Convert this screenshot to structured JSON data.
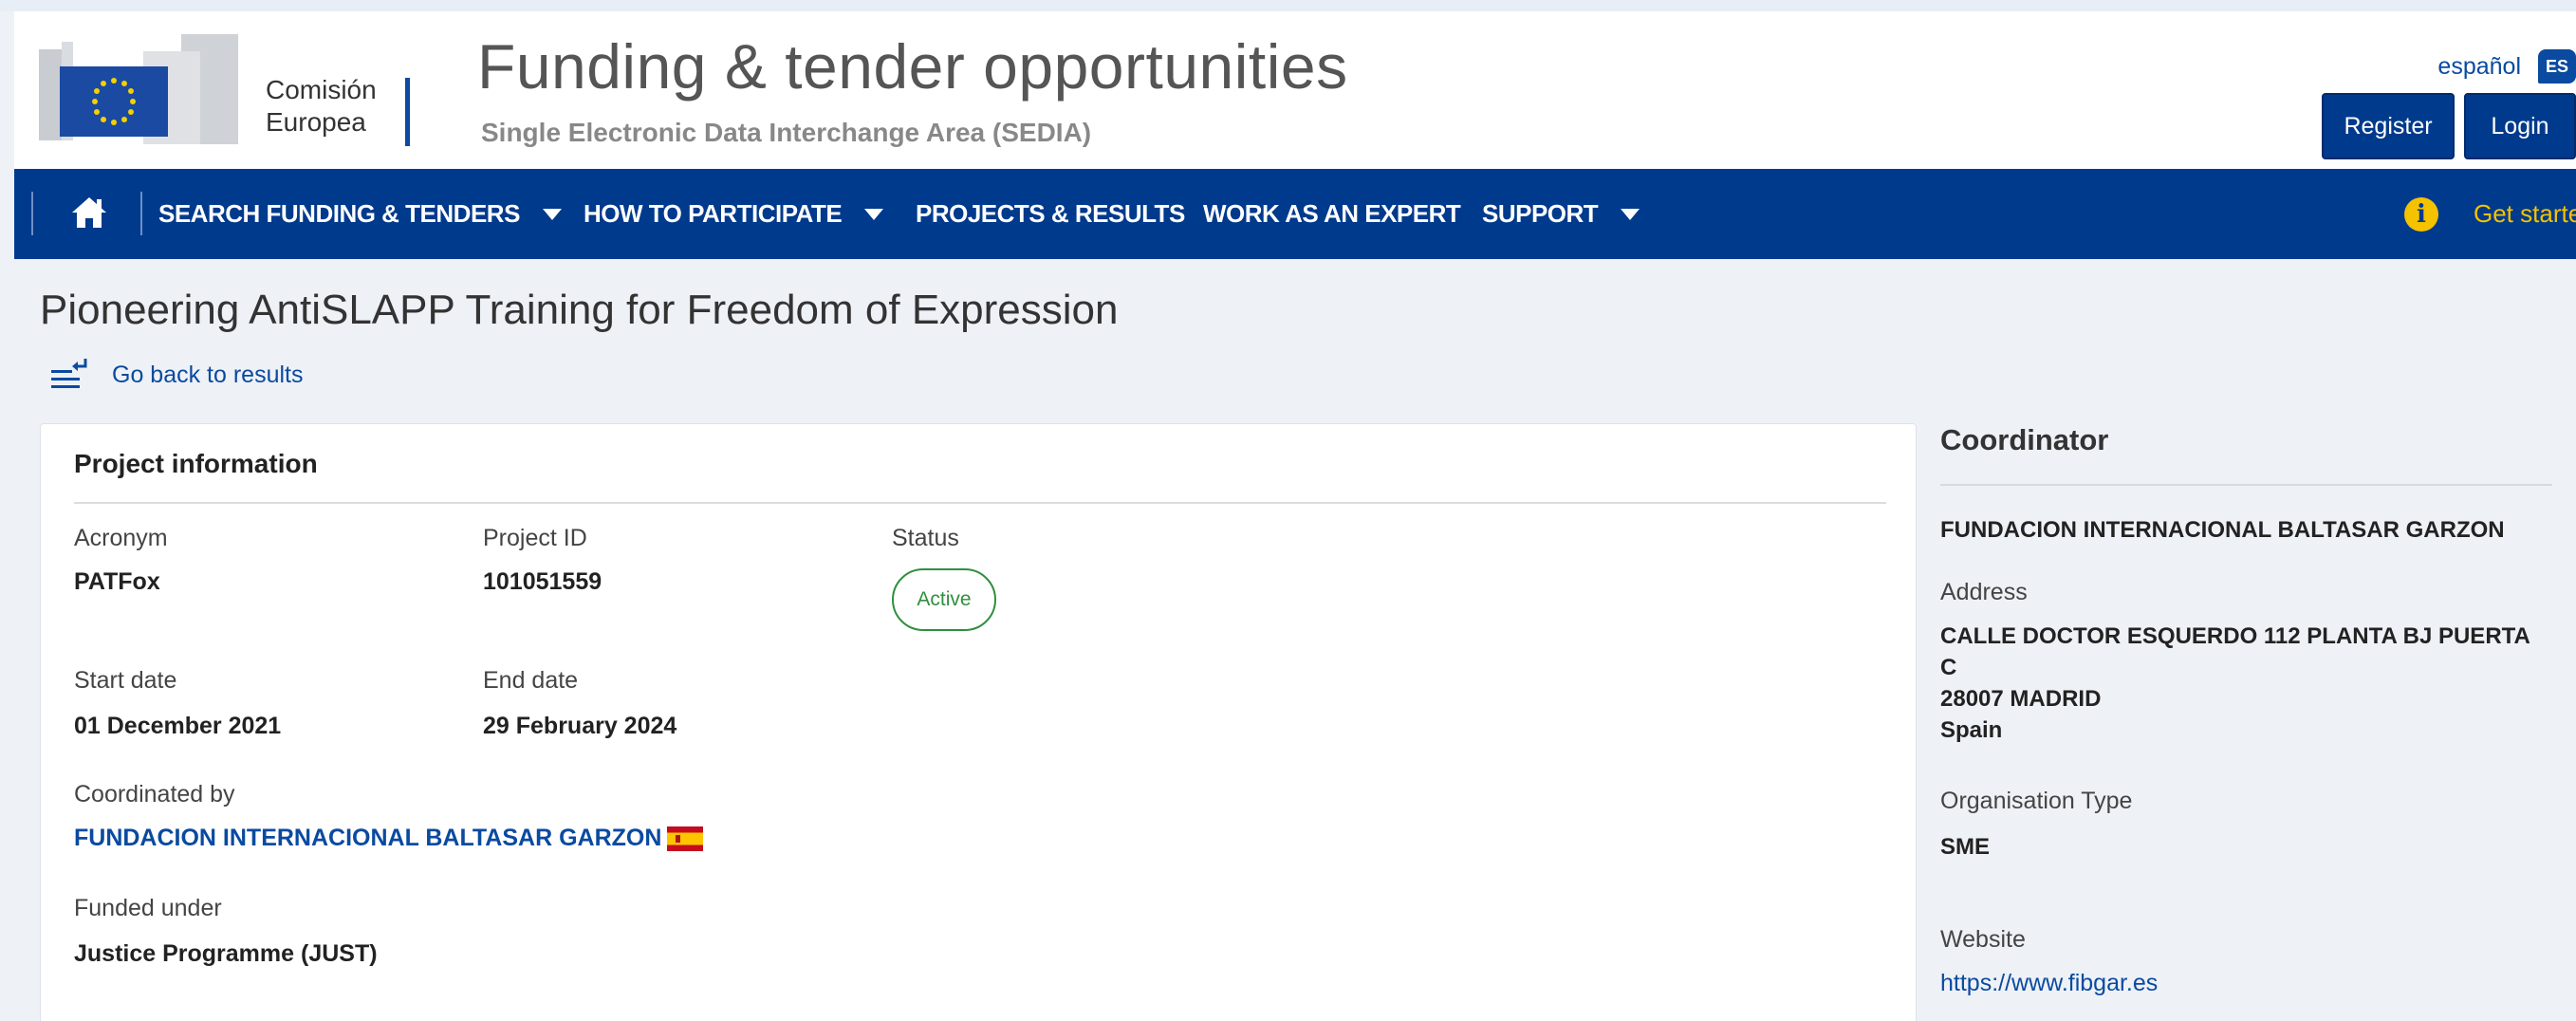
{
  "header": {
    "logo_lines": [
      "Comisión",
      "Europea"
    ],
    "title": "Funding & tender opportunities",
    "subtitle": "Single Electronic Data Interchange Area (SEDIA)",
    "language": "español",
    "language_code": "ES",
    "register_label": "Register",
    "login_label": "Login"
  },
  "nav": {
    "items": [
      {
        "label": "SEARCH FUNDING & TENDERS",
        "has_dropdown": true
      },
      {
        "label": "HOW TO PARTICIPATE",
        "has_dropdown": true
      },
      {
        "label": "PROJECTS & RESULTS",
        "has_dropdown": false
      },
      {
        "label": "WORK AS AN EXPERT",
        "has_dropdown": false
      },
      {
        "label": "SUPPORT",
        "has_dropdown": true
      }
    ],
    "get_started": "Get started",
    "icons": [
      "home-icon",
      "info-icon"
    ]
  },
  "page": {
    "title": "Pioneering AntiSLAPP Training for Freedom of Expression",
    "back_label": "Go back to results"
  },
  "project": {
    "section_title": "Project information",
    "acronym_label": "Acronym",
    "acronym": "PATFox",
    "project_id_label": "Project ID",
    "project_id": "101051559",
    "status_label": "Status",
    "status": "Active",
    "start_label": "Start date",
    "start": "01 December 2021",
    "end_label": "End date",
    "end": "29 February 2024",
    "coordinated_by_label": "Coordinated by",
    "coordinated_by": "FUNDACION INTERNACIONAL BALTASAR GARZON",
    "funded_under_label": "Funded under",
    "funded_under": "Justice Programme (JUST)"
  },
  "coordinator": {
    "title": "Coordinator",
    "name": "FUNDACION INTERNACIONAL BALTASAR GARZON",
    "address_label": "Address",
    "address_lines": [
      "CALLE DOCTOR ESQUERDO 112 PLANTA BJ PUERTA",
      "C",
      "28007 MADRID",
      "Spain"
    ],
    "org_type_label": "Organisation Type",
    "org_type": "SME",
    "website_label": "Website",
    "website": "https://www.fibgar.es"
  },
  "colors": {
    "nav_blue": "#003a8c",
    "link_blue": "#0a4aa0",
    "status_green": "#2f8f3f",
    "accent_yellow": "#f5c200"
  }
}
